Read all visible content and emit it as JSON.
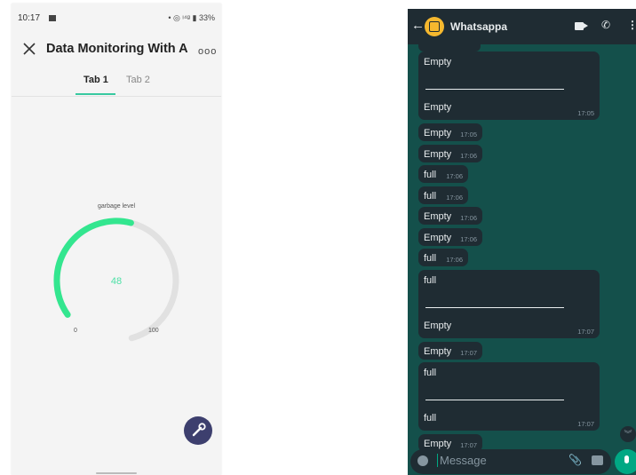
{
  "left_phone": {
    "status": {
      "time": "10:17",
      "right": "• ◎ ᵎ⁴ᵍ ▮ 33%"
    },
    "title": "Data Monitoring With A...",
    "more": "ooo",
    "tabs": [
      "Tab 1",
      "Tab 2"
    ],
    "gauge": {
      "label": "garbage level",
      "value": 48,
      "value_text": "48",
      "min": "0",
      "max": "100",
      "color": "#33e68f",
      "track_color": "#e1e1e1"
    },
    "icons": {
      "close": "close-icon",
      "fab": "wrench-icon"
    }
  },
  "right_phone": {
    "header": {
      "name": "Whatsappa"
    },
    "partial_time": "17:05",
    "messages": [
      {
        "multi": true,
        "line1": "Empty",
        "line2": "Empty",
        "time": "17:05"
      },
      {
        "text": "Empty",
        "time": "17:05"
      },
      {
        "text": "Empty",
        "time": "17:06"
      },
      {
        "text": "full",
        "time": "17:06"
      },
      {
        "text": "full",
        "time": "17:06"
      },
      {
        "text": "Empty",
        "time": "17:06"
      },
      {
        "text": "Empty",
        "time": "17:06"
      },
      {
        "text": "full",
        "time": "17:06"
      },
      {
        "multi": true,
        "line1": "full",
        "line2": "Empty",
        "time": "17:07"
      },
      {
        "text": "Empty",
        "time": "17:07"
      },
      {
        "multi": true,
        "line1": "full",
        "line2": "full",
        "time": "17:07"
      },
      {
        "text": "Empty",
        "time": "17:07"
      }
    ],
    "input": {
      "placeholder": "Message"
    },
    "colors": {
      "header": "#1f2c33",
      "bubble": "#1f2c33",
      "accent": "#00a884",
      "wallpaper": "#14504b"
    }
  }
}
